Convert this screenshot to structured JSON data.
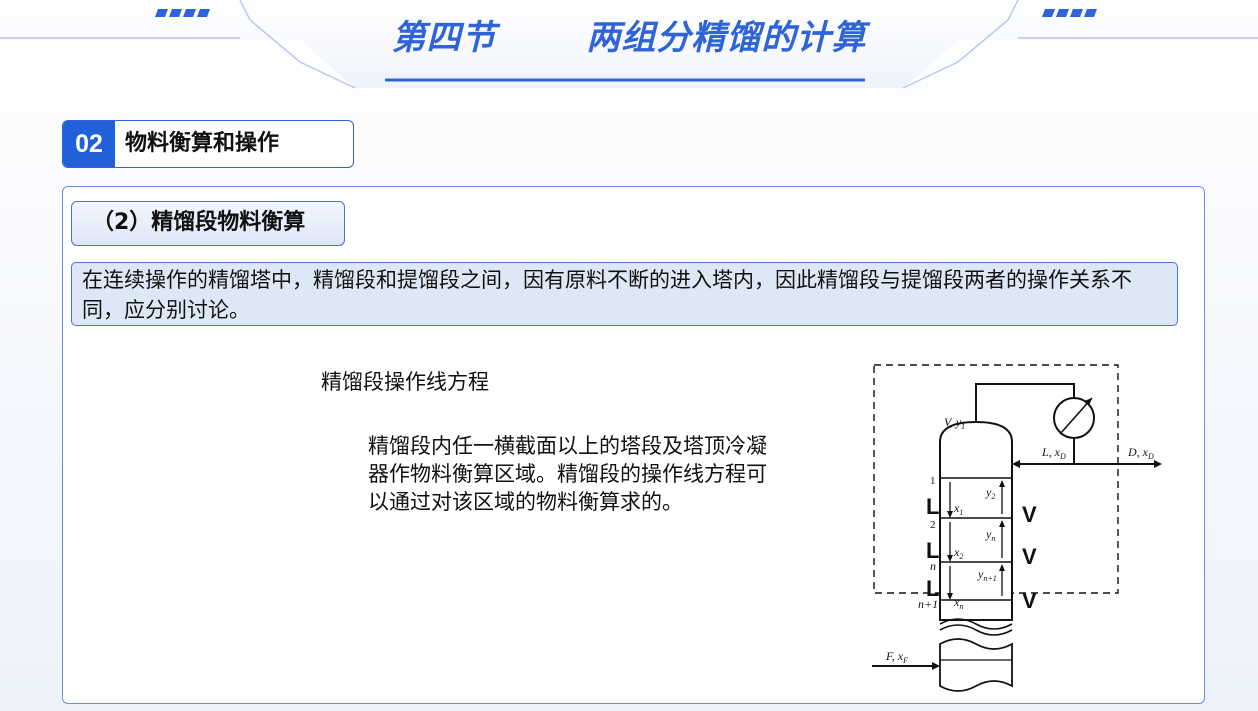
{
  "header": {
    "section_title": "第四节",
    "topic_title": "两组分精馏的计算"
  },
  "section": {
    "number": "02",
    "label": "物料衡算和操作"
  },
  "subsection": {
    "label": "（2）精馏段物料衡算"
  },
  "intro_text": "在连续操作的精馏塔中，精馏段和提馏段之间，因有原料不断的进入塔内，因此精馏段与提馏段两者的操作关系不同，应分别讨论。",
  "heading": "精馏段操作线方程",
  "description": "精馏段内任一横截面以上的塔段及塔顶冷凝器作物料衡算区域。精馏段的操作线方程可以通过对该区域的物料衡算求的。",
  "diagram": {
    "vapor_top": "V, y",
    "vapor_top_sub": "1",
    "reflux": "L, x",
    "reflux_sub": "D",
    "distillate": "D, x",
    "distillate_sub": "D",
    "feed": "F, x",
    "feed_sub": "F",
    "plate_1": "1",
    "plate_2": "2",
    "plate_n": "n",
    "plate_n1": "n+1",
    "liquid_label": "L",
    "vapor_label": "V",
    "x1": "x",
    "x1_sub": "1",
    "x2": "x",
    "x2_sub": "2",
    "xn": "x",
    "xn_sub": "n",
    "y2": "y",
    "y2_sub": "2",
    "yn": "y",
    "yn_sub": "n",
    "yn1": "y",
    "yn1_sub": "n+1"
  },
  "colors": {
    "accent": "#2f63d8",
    "intro_bg": "#dde8f6",
    "border": "#4a74d0"
  }
}
